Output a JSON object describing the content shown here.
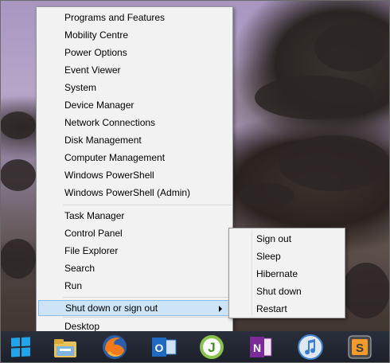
{
  "context_menu": {
    "group1": [
      {
        "label": "Programs and Features"
      },
      {
        "label": "Mobility Centre"
      },
      {
        "label": "Power Options"
      },
      {
        "label": "Event Viewer"
      },
      {
        "label": "System"
      },
      {
        "label": "Device Manager"
      },
      {
        "label": "Network Connections"
      },
      {
        "label": "Disk Management"
      },
      {
        "label": "Computer Management"
      },
      {
        "label": "Windows PowerShell"
      },
      {
        "label": "Windows PowerShell (Admin)"
      }
    ],
    "group2": [
      {
        "label": "Task Manager"
      },
      {
        "label": "Control Panel"
      },
      {
        "label": "File Explorer"
      },
      {
        "label": "Search"
      },
      {
        "label": "Run"
      }
    ],
    "shutdown": {
      "label": "Shut down or sign out"
    },
    "desktop": {
      "label": "Desktop"
    }
  },
  "submenu": [
    {
      "label": "Sign out"
    },
    {
      "label": "Sleep"
    },
    {
      "label": "Hibernate"
    },
    {
      "label": "Shut down"
    },
    {
      "label": "Restart"
    }
  ],
  "taskbar": {
    "apps": [
      "start-icon",
      "file-explorer-icon",
      "firefox-icon",
      "outlook-icon",
      "jdownloader-icon",
      "onenote-icon",
      "itunes-icon",
      "sublime-text-icon"
    ],
    "outlook_letter": "O",
    "jd_letter": "J",
    "onenote_letter": "N",
    "sublime_letter": "S"
  },
  "colors": {
    "highlight": "#cde4f7",
    "start_blue": "#22a4ea"
  }
}
